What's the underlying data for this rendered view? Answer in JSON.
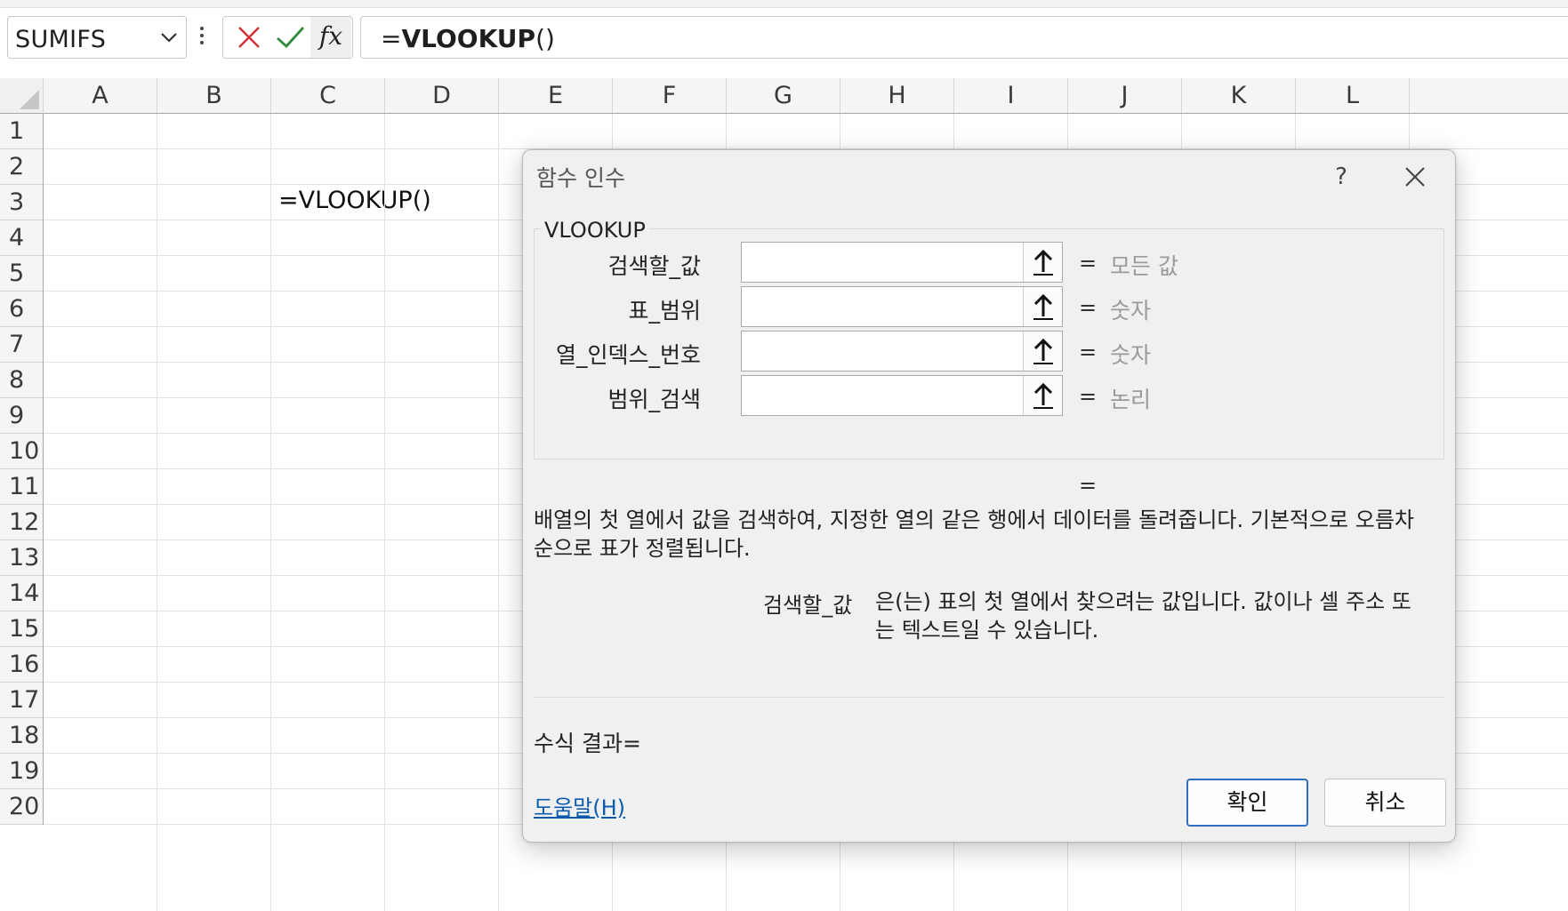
{
  "formula_bar": {
    "name_box": "SUMIFS",
    "fx_label": "fx",
    "formula_eq": "=",
    "formula_name": "VLOOKUP",
    "formula_paren": "()"
  },
  "grid": {
    "columns": [
      "A",
      "B",
      "C",
      "D",
      "E",
      "F",
      "G",
      "H",
      "I",
      "J",
      "K",
      "L"
    ],
    "rows": [
      "1",
      "2",
      "3",
      "4",
      "5",
      "6",
      "7",
      "8",
      "9",
      "10",
      "11",
      "12",
      "13",
      "14",
      "15",
      "16",
      "17",
      "18",
      "19",
      "20"
    ],
    "cell_c3": "=VLOOKUP()"
  },
  "dialog": {
    "title": "함수 인수",
    "help_glyph": "?",
    "function_name": "VLOOKUP",
    "args": [
      {
        "label": "검색할_값",
        "equals": "=",
        "hint": "모든 값"
      },
      {
        "label": "표_범위",
        "equals": "=",
        "hint": "숫자"
      },
      {
        "label": "열_인덱스_번호",
        "equals": "=",
        "hint": "숫자"
      },
      {
        "label": "범위_검색",
        "equals": "=",
        "hint": "논리"
      }
    ],
    "result_equals": "=",
    "description": "배열의 첫 열에서 값을 검색하여, 지정한 열의 같은 행에서 데이터를 돌려줍니다. 기본적으로 오름차순으로 표가 정렬됩니다.",
    "arg_desc_name": "검색할_값",
    "arg_desc_text": "은(는) 표의 첫 열에서 찾으려는 값입니다. 값이나 셀 주소 또는 텍스트일 수 있습니다.",
    "formula_result": "수식 결과=",
    "help_link": "도움말(H)",
    "ok": "확인",
    "cancel": "취소"
  }
}
